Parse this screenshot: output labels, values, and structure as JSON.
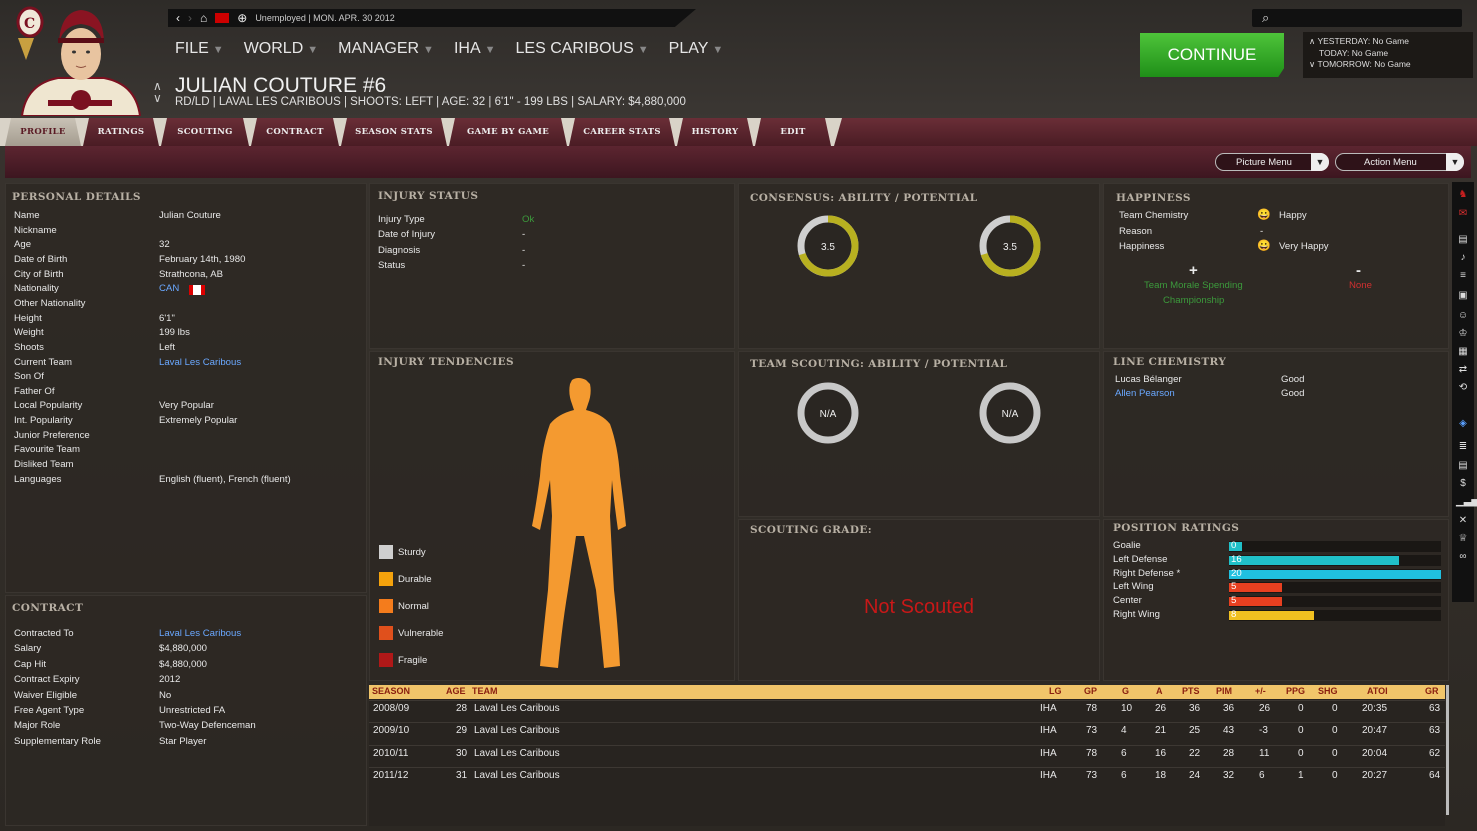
{
  "header": {
    "breadcrumb_status": "Unemployed | MON. APR. 30 2012",
    "menu": [
      "FILE",
      "WORLD",
      "MANAGER",
      "IHA",
      "LES CARIBOUS",
      "PLAY"
    ],
    "player_name": "JULIAN COUTURE #6",
    "player_info": "RD/LD | LAVAL LES CARIBOUS | SHOOTS: LEFT | AGE: 32 | 6'1\" - 199 LBS | SALARY: $4,880,000",
    "continue_label": "CONTINUE",
    "schedule": [
      "YESTERDAY: No Game",
      "TODAY: No Game",
      "TOMORROW: No Game"
    ]
  },
  "tabs": [
    "PROFILE",
    "RATINGS",
    "SCOUTING",
    "CONTRACT",
    "SEASON STATS",
    "GAME BY GAME",
    "CAREER STATS",
    "HISTORY",
    "EDIT"
  ],
  "active_tab": "PROFILE",
  "subbar": {
    "picture_menu": "Picture Menu",
    "action_menu": "Action Menu"
  },
  "personal": {
    "title": "PERSONAL DETAILS",
    "rows": [
      [
        "Name",
        "Julian Couture"
      ],
      [
        "Nickname",
        ""
      ],
      [
        "Age",
        "32"
      ],
      [
        "Date of Birth",
        "February 14th, 1980"
      ],
      [
        "City of Birth",
        "Strathcona, AB"
      ],
      [
        "Nationality",
        "CAN"
      ],
      [
        "Other Nationality",
        ""
      ],
      [
        "Height",
        "6'1\""
      ],
      [
        "Weight",
        "199 lbs"
      ],
      [
        "Shoots",
        "Left"
      ],
      [
        "Current Team",
        "Laval Les Caribous"
      ],
      [
        "Son Of",
        ""
      ],
      [
        "Father Of",
        ""
      ],
      [
        "Local Popularity",
        "Very Popular"
      ],
      [
        "Int. Popularity",
        "Extremely Popular"
      ],
      [
        "Junior Preference",
        ""
      ],
      [
        "Favourite Team",
        ""
      ],
      [
        "Disliked Team",
        ""
      ],
      [
        "Languages",
        "English (fluent), French (fluent)"
      ]
    ]
  },
  "contract": {
    "title": "CONTRACT",
    "rows": [
      [
        "Contracted To",
        "Laval Les Caribous"
      ],
      [
        "Salary",
        "$4,880,000"
      ],
      [
        "Cap Hit",
        "$4,880,000"
      ],
      [
        "Contract Expiry",
        "2012"
      ],
      [
        "Waiver Eligible",
        "No"
      ],
      [
        "Free Agent Type",
        "Unrestricted FA"
      ],
      [
        "Major Role",
        "Two-Way Defenceman"
      ],
      [
        "Supplementary Role",
        "Star Player"
      ]
    ]
  },
  "injury": {
    "title": "INJURY STATUS",
    "rows": [
      [
        "Injury Type",
        "Ok"
      ],
      [
        "Date of Injury",
        "-"
      ],
      [
        "Diagnosis",
        "-"
      ],
      [
        "Status",
        "-"
      ]
    ]
  },
  "tendencies": {
    "title": "INJURY TENDENCIES",
    "legend": [
      {
        "label": "Sturdy",
        "color": "#cfcfcf"
      },
      {
        "label": "Durable",
        "color": "#f4a20c"
      },
      {
        "label": "Normal",
        "color": "#f47c1c"
      },
      {
        "label": "Vulnerable",
        "color": "#e0501c"
      },
      {
        "label": "Fragile",
        "color": "#b01818"
      }
    ],
    "body_color": "#f49a30"
  },
  "consensus": {
    "title": "CONSENSUS: ABILITY / POTENTIAL",
    "ability": "3.5",
    "potential": "3.5",
    "ability_fill": 0.7,
    "potential_fill": 0.7
  },
  "team_scouting": {
    "title": "TEAM SCOUTING: ABILITY / POTENTIAL",
    "ability": "N/A",
    "potential": "N/A"
  },
  "scouting_grade": {
    "title": "SCOUTING GRADE:",
    "status": "Not Scouted"
  },
  "happiness": {
    "title": "HAPPINESS",
    "rows": [
      [
        "Team Chemistry",
        "Happy"
      ],
      [
        "Reason",
        "-"
      ],
      [
        "Happiness",
        "Very Happy"
      ]
    ],
    "plus": "+",
    "minus": "-",
    "positives": [
      "Team Morale Spending",
      "Championship"
    ],
    "negatives": [
      "None"
    ]
  },
  "line_chemistry": {
    "title": "LINE CHEMISTRY",
    "rows": [
      [
        "Lucas Bélanger",
        "Good"
      ],
      [
        "Allen Pearson",
        "Good"
      ]
    ]
  },
  "position_ratings": {
    "title": "POSITION RATINGS",
    "max": 20,
    "rows": [
      {
        "label": "Goalie",
        "value": 0,
        "color": "#20c0c8"
      },
      {
        "label": "Left Defense",
        "value": 16,
        "color": "#20c0c8"
      },
      {
        "label": "Right Defense *",
        "value": 20,
        "color": "#20c0e0"
      },
      {
        "label": "Left Wing",
        "value": 5,
        "color": "#e84020"
      },
      {
        "label": "Center",
        "value": 5,
        "color": "#e84020"
      },
      {
        "label": "Right Wing",
        "value": 8,
        "color": "#f0c020"
      }
    ]
  },
  "stats": {
    "headers": [
      "SEASON",
      "AGE",
      "TEAM",
      "LG",
      "GP",
      "G",
      "A",
      "PTS",
      "PIM",
      "+/-",
      "PPG",
      "SHG",
      "ATOI",
      "GR"
    ],
    "rows": [
      [
        "2008/09",
        "28",
        "Laval Les Caribous",
        "IHA",
        "78",
        "10",
        "26",
        "36",
        "36",
        "26",
        "0",
        "0",
        "20:35",
        "63"
      ],
      [
        "2009/10",
        "29",
        "Laval Les Caribous",
        "IHA",
        "73",
        "4",
        "21",
        "25",
        "43",
        "-3",
        "0",
        "0",
        "20:47",
        "63"
      ],
      [
        "2010/11",
        "30",
        "Laval Les Caribous",
        "IHA",
        "78",
        "6",
        "16",
        "22",
        "28",
        "11",
        "0",
        "0",
        "20:04",
        "62"
      ],
      [
        "2011/12",
        "31",
        "Laval Les Caribous",
        "IHA",
        "73",
        "6",
        "18",
        "24",
        "32",
        "6",
        "1",
        "0",
        "20:27",
        "64"
      ]
    ]
  }
}
